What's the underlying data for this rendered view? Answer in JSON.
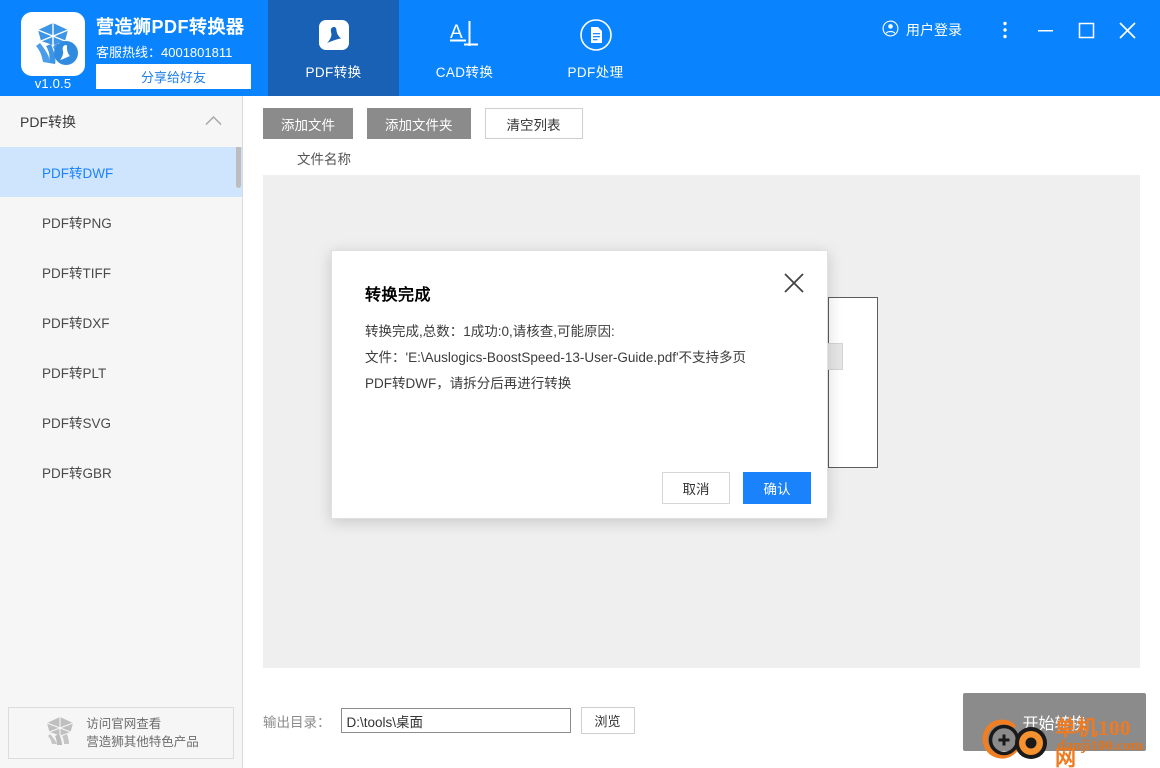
{
  "app": {
    "title": "营造狮PDF转换器",
    "hotline": "客服热线：4001801811",
    "version": "v1.0.5",
    "share_label": "分享给好友",
    "logo_icon": "lion-pdf-logo-icon"
  },
  "header": {
    "tabs": [
      {
        "label": "PDF转换",
        "icon": "pdf-acrobat-icon",
        "active": true
      },
      {
        "label": "CAD转换",
        "icon": "cad-dimension-icon",
        "active": false
      },
      {
        "label": "PDF处理",
        "icon": "pdf-document-circle-icon",
        "active": false
      }
    ],
    "user_login_label": "用户登录",
    "user_icon": "user-circle-icon",
    "more_icon": "more-vertical-icon",
    "minimize_icon": "minimize-icon",
    "maximize_icon": "maximize-icon",
    "close_icon": "close-icon",
    "bg_color": "#0a84fe",
    "active_tab_color": "#1861b5"
  },
  "sidebar": {
    "group_label": "PDF转换",
    "group_caret_icon": "chevron-up-icon",
    "items": [
      {
        "label": "PDF转DWF",
        "active": true
      },
      {
        "label": "PDF转PNG",
        "active": false
      },
      {
        "label": "PDF转TIFF",
        "active": false
      },
      {
        "label": "PDF转DXF",
        "active": false
      },
      {
        "label": "PDF转PLT",
        "active": false
      },
      {
        "label": "PDF转SVG",
        "active": false
      },
      {
        "label": "PDF转GBR",
        "active": false
      }
    ],
    "footer": {
      "line1": "访问官网查看",
      "line2": "营造狮其他特色产品",
      "icon": "lion-gray-logo-icon"
    },
    "active_bg": "#cfe5fd",
    "active_color": "#1a82fb"
  },
  "main": {
    "toolbar": {
      "add_file_label": "添加文件",
      "add_folder_label": "添加文件夹",
      "clear_list_label": "清空列表"
    },
    "column_header": "文件名称",
    "output": {
      "label": "输出目录：",
      "value": "D:\\tools\\桌面",
      "placeholder": "D:\\tools\\桌面",
      "browse_label": "浏览"
    },
    "start_button_label": "开始转换"
  },
  "modal": {
    "title": "转换完成",
    "close_icon": "close-icon",
    "line1": "转换完成,总数：1成功:0,请核查,可能原因:",
    "line2": "文件：'E:\\Auslogics-BoostSpeed-13-User-Guide.pdf'不支持多页",
    "line3": "PDF转DWF，请拆分后再进行转换",
    "cancel_label": "取消",
    "confirm_label": "确认",
    "confirm_color": "#1a82fb"
  },
  "watermark": {
    "text_cn": "单机100网",
    "text_en": "danji100.com",
    "color": "#f07a1f",
    "icon": "danji100-logo-icon"
  }
}
